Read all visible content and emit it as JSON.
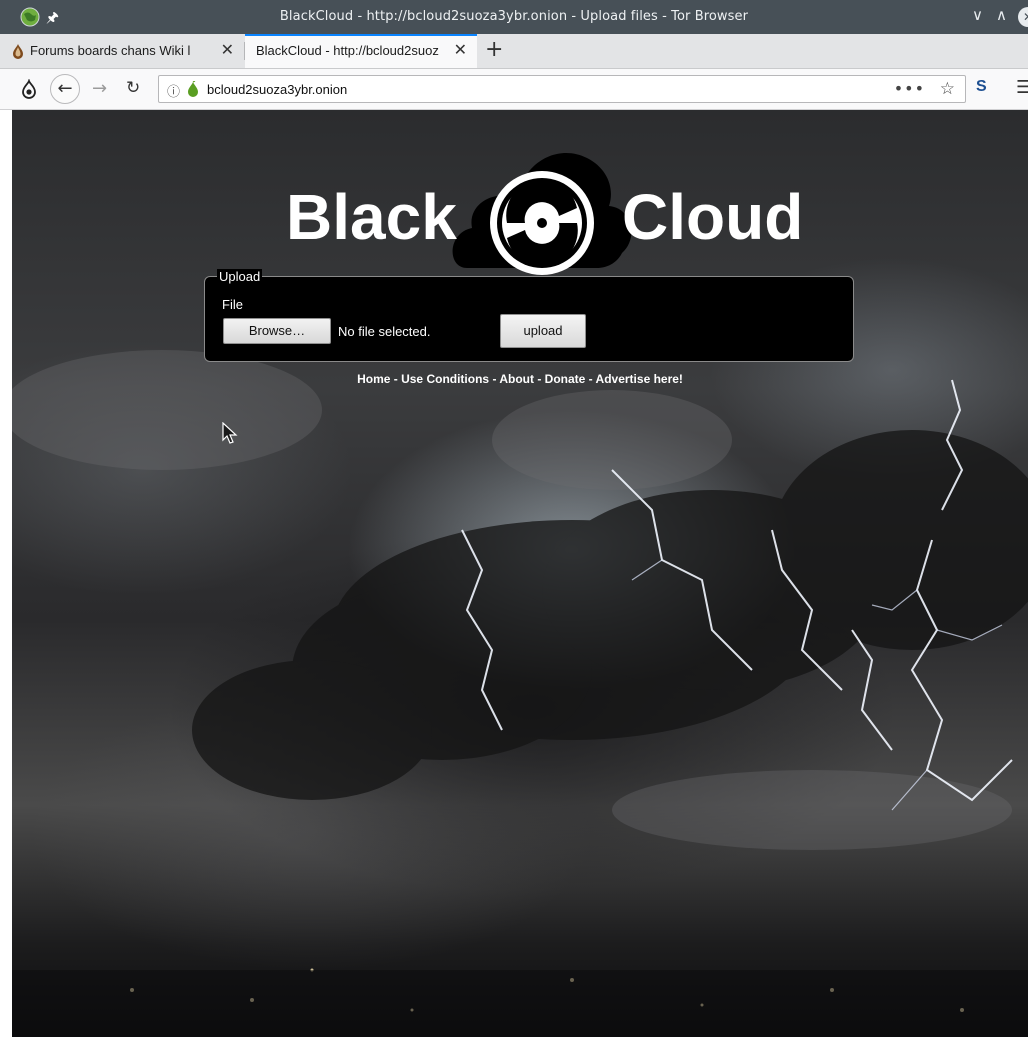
{
  "window": {
    "title": "BlackCloud - http://bcloud2suoza3ybr.onion - Upload files - Tor Browser"
  },
  "tabs": [
    {
      "label": "Forums boards chans Wiki l",
      "active": false
    },
    {
      "label": "BlackCloud - http://bcloud2suoz",
      "active": true
    }
  ],
  "navbar": {
    "url": "bcloud2suoza3ybr.onion",
    "more": "•••",
    "s_label": "S"
  },
  "page": {
    "logo": {
      "left": "Black",
      "right": "Cloud"
    },
    "upload": {
      "legend": "Upload",
      "file_label": "File",
      "browse_label": "Browse…",
      "file_status": "No file selected.",
      "upload_label": "upload"
    },
    "footer_links": [
      {
        "label": "Home"
      },
      {
        "label": "Use Conditions"
      },
      {
        "label": "About"
      },
      {
        "label": "Donate"
      },
      {
        "label": "Advertise here!"
      }
    ],
    "footer_sep": " - "
  },
  "colors": {
    "titlebar": "#475057",
    "active_tab_accent": "#0a84ff",
    "upload_box_bg": "#000000",
    "link_text": "#ffffff"
  },
  "icons": {
    "titlebar_app": "globe-icon",
    "titlebar_pin": "pin-icon",
    "tab_favicon": "onion-icon",
    "identity": "info-icon",
    "page_onion": "onion-icon",
    "bookmark": "star-icon"
  }
}
